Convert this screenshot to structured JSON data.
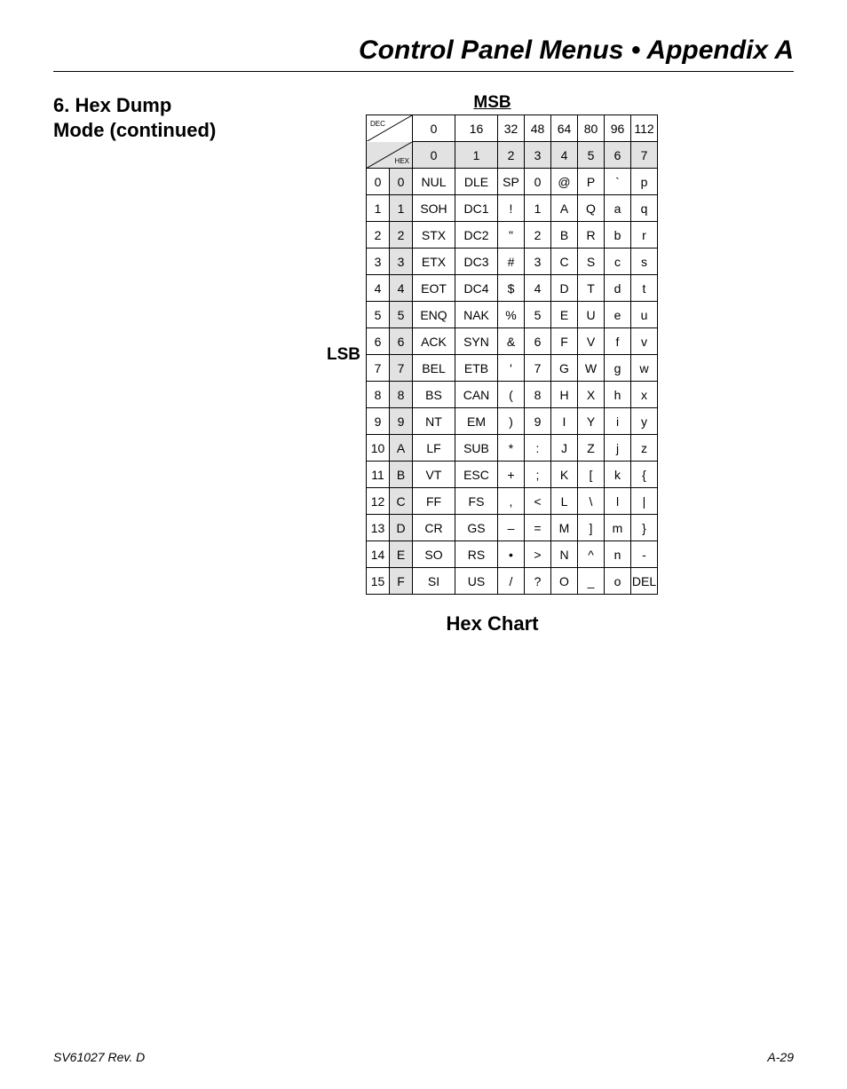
{
  "header": "Control Panel Menus • Appendix A",
  "section": {
    "line1": "6. Hex Dump",
    "line2": "Mode (continued)"
  },
  "msb": "MSB",
  "lsb": "LSB",
  "dec_label": "DEC",
  "hex_label": "HEX",
  "chart_title": "Hex Chart",
  "dec_tops": [
    "0",
    "16",
    "32",
    "48",
    "64",
    "80",
    "96",
    "112"
  ],
  "hex_tops": [
    "0",
    "1",
    "2",
    "3",
    "4",
    "5",
    "6",
    "7"
  ],
  "rows": [
    {
      "d": "0",
      "h": "0",
      "c": [
        "NUL",
        "DLE",
        "SP",
        "0",
        "@",
        "P",
        "`",
        "p"
      ]
    },
    {
      "d": "1",
      "h": "1",
      "c": [
        "SOH",
        "DC1",
        "!",
        "1",
        "A",
        "Q",
        "a",
        "q"
      ]
    },
    {
      "d": "2",
      "h": "2",
      "c": [
        "STX",
        "DC2",
        "\"",
        "2",
        "B",
        "R",
        "b",
        "r"
      ]
    },
    {
      "d": "3",
      "h": "3",
      "c": [
        "ETX",
        "DC3",
        "#",
        "3",
        "C",
        "S",
        "c",
        "s"
      ]
    },
    {
      "d": "4",
      "h": "4",
      "c": [
        "EOT",
        "DC4",
        "$",
        "4",
        "D",
        "T",
        "d",
        "t"
      ]
    },
    {
      "d": "5",
      "h": "5",
      "c": [
        "ENQ",
        "NAK",
        "%",
        "5",
        "E",
        "U",
        "e",
        "u"
      ]
    },
    {
      "d": "6",
      "h": "6",
      "c": [
        "ACK",
        "SYN",
        "&",
        "6",
        "F",
        "V",
        "f",
        "v"
      ]
    },
    {
      "d": "7",
      "h": "7",
      "c": [
        "BEL",
        "ETB",
        "'",
        "7",
        "G",
        "W",
        "g",
        "w"
      ]
    },
    {
      "d": "8",
      "h": "8",
      "c": [
        "BS",
        "CAN",
        "(",
        "8",
        "H",
        "X",
        "h",
        "x"
      ]
    },
    {
      "d": "9",
      "h": "9",
      "c": [
        "NT",
        "EM",
        ")",
        "9",
        "I",
        "Y",
        "i",
        "y"
      ]
    },
    {
      "d": "10",
      "h": "A",
      "c": [
        "LF",
        "SUB",
        "*",
        ":",
        "J",
        "Z",
        "j",
        "z"
      ]
    },
    {
      "d": "11",
      "h": "B",
      "c": [
        "VT",
        "ESC",
        "+",
        ";",
        "K",
        "[",
        "k",
        "{"
      ]
    },
    {
      "d": "12",
      "h": "C",
      "c": [
        "FF",
        "FS",
        ",",
        "<",
        "L",
        "\\",
        "l",
        "|"
      ]
    },
    {
      "d": "13",
      "h": "D",
      "c": [
        "CR",
        "GS",
        "–",
        "=",
        "M",
        "]",
        "m",
        "}"
      ]
    },
    {
      "d": "14",
      "h": "E",
      "c": [
        "SO",
        "RS",
        "•",
        ">",
        "N",
        "^",
        "n",
        "-"
      ]
    },
    {
      "d": "15",
      "h": "F",
      "c": [
        "SI",
        "US",
        "/",
        "?",
        "O",
        "_",
        "o",
        "DEL"
      ]
    }
  ],
  "footer": {
    "left": "SV61027 Rev. D",
    "right": "A-29"
  }
}
